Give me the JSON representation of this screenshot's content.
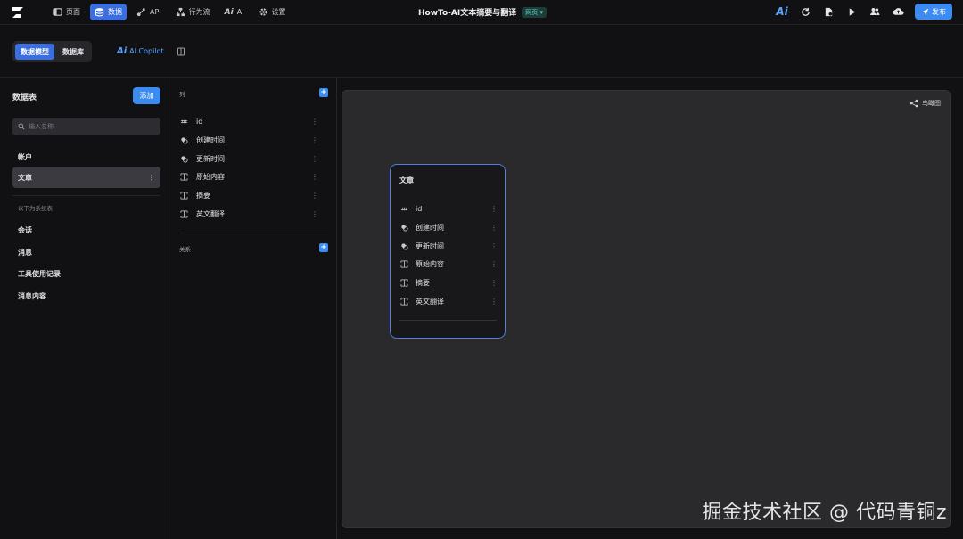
{
  "topbar": {
    "nav": [
      {
        "label": "页面",
        "icon": "page-icon"
      },
      {
        "label": "数据",
        "icon": "database-icon",
        "active": true
      },
      {
        "label": "API",
        "icon": "api-icon"
      },
      {
        "label": "行为流",
        "icon": "flow-icon"
      },
      {
        "label": "AI",
        "icon": "ai-icon"
      },
      {
        "label": "设置",
        "icon": "gear-icon"
      }
    ],
    "project_title": "HowTo-AI文本摘要与翻译",
    "page_badge": "网页 ▾",
    "publish_label": "发布"
  },
  "subbar": {
    "tabs": [
      "数据模型",
      "数据库"
    ],
    "active_tab": "数据模型",
    "copilot_label": "AI Copilot"
  },
  "left_panel": {
    "heading": "数据表",
    "add_label": "添加",
    "search_placeholder": "输入名称",
    "tables": [
      "帐户",
      "文章"
    ],
    "selected_table": "文章",
    "system_note": "以下为系统表",
    "system_tables": [
      "会话",
      "消息",
      "工具使用记录",
      "消息内容"
    ]
  },
  "columns_panel": {
    "columns_heading": "列",
    "columns": [
      {
        "name": "id",
        "type_icon": "id-icon"
      },
      {
        "name": "创建时间",
        "type_icon": "timestamp-icon"
      },
      {
        "name": "更新时间",
        "type_icon": "timestamp-icon"
      },
      {
        "name": "原始内容",
        "type_icon": "text-icon"
      },
      {
        "name": "摘要",
        "type_icon": "text-icon"
      },
      {
        "name": "英文翻译",
        "type_icon": "text-icon"
      }
    ],
    "relations_heading": "关系"
  },
  "canvas": {
    "birdview_label": "鸟瞰图",
    "card": {
      "title": "文章",
      "fields": [
        "id",
        "创建时间",
        "更新时间",
        "原始内容",
        "摘要",
        "英文翻译"
      ]
    }
  },
  "watermark": "掘金技术社区 @ 代码青铜z",
  "colors": {
    "accent": "#3b6fe0",
    "button": "#3b8bf0",
    "badge_text": "#63d3c1",
    "card_border": "#4d7fe8"
  }
}
